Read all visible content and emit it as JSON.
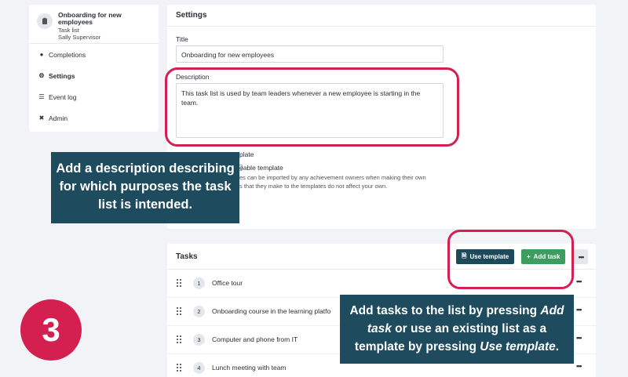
{
  "sidebar": {
    "list_title": "Onboarding for new employees",
    "list_type": "Task list",
    "owner": "Sally Supervisor",
    "items": [
      {
        "label": "Completions",
        "icon": "person-icon"
      },
      {
        "label": "Settings",
        "icon": "gear-icon"
      },
      {
        "label": "Event log",
        "icon": "list-icon"
      },
      {
        "label": "Admin",
        "icon": "tools-icon"
      }
    ]
  },
  "settings": {
    "heading": "Settings",
    "title_label": "Title",
    "title_value": "Onboarding for new employees",
    "description_label": "Description",
    "description_value": "This task list is used by team leaders whenever a new employee is starting in the team.",
    "template_label_partial": "plate",
    "template_checkbox_partial": "eable template",
    "template_help_line1": "es can be imported by any achievement owners when making their own",
    "template_help_line2": "s that they make to the templates do not affect your own."
  },
  "tasks": {
    "heading": "Tasks",
    "use_template_label": "Use template",
    "add_task_label": "Add task",
    "more_label": "•••",
    "rows": [
      {
        "num": "1",
        "name": "Office tour"
      },
      {
        "num": "2",
        "name": "Onboarding course in the learning platfo"
      },
      {
        "num": "3",
        "name": "Computer and phone from IT"
      },
      {
        "num": "4",
        "name": "Lunch meeting with team"
      }
    ]
  },
  "callouts": {
    "description_tip": "Add a description describing for which purposes the task list is intended.",
    "tasks_tip_part1": "Add tasks to the list by pressing ",
    "tasks_tip_em1": "Add task",
    "tasks_tip_part2": " or use an existing list as a template by pressing ",
    "tasks_tip_em2": "Use template",
    "tasks_tip_end": "."
  },
  "step_number": "3",
  "colors": {
    "highlight": "#d42050",
    "callout_bg": "#1e4b5e",
    "use_template_btn": "#1c4a5a",
    "add_task_btn": "#3e9c5e"
  }
}
